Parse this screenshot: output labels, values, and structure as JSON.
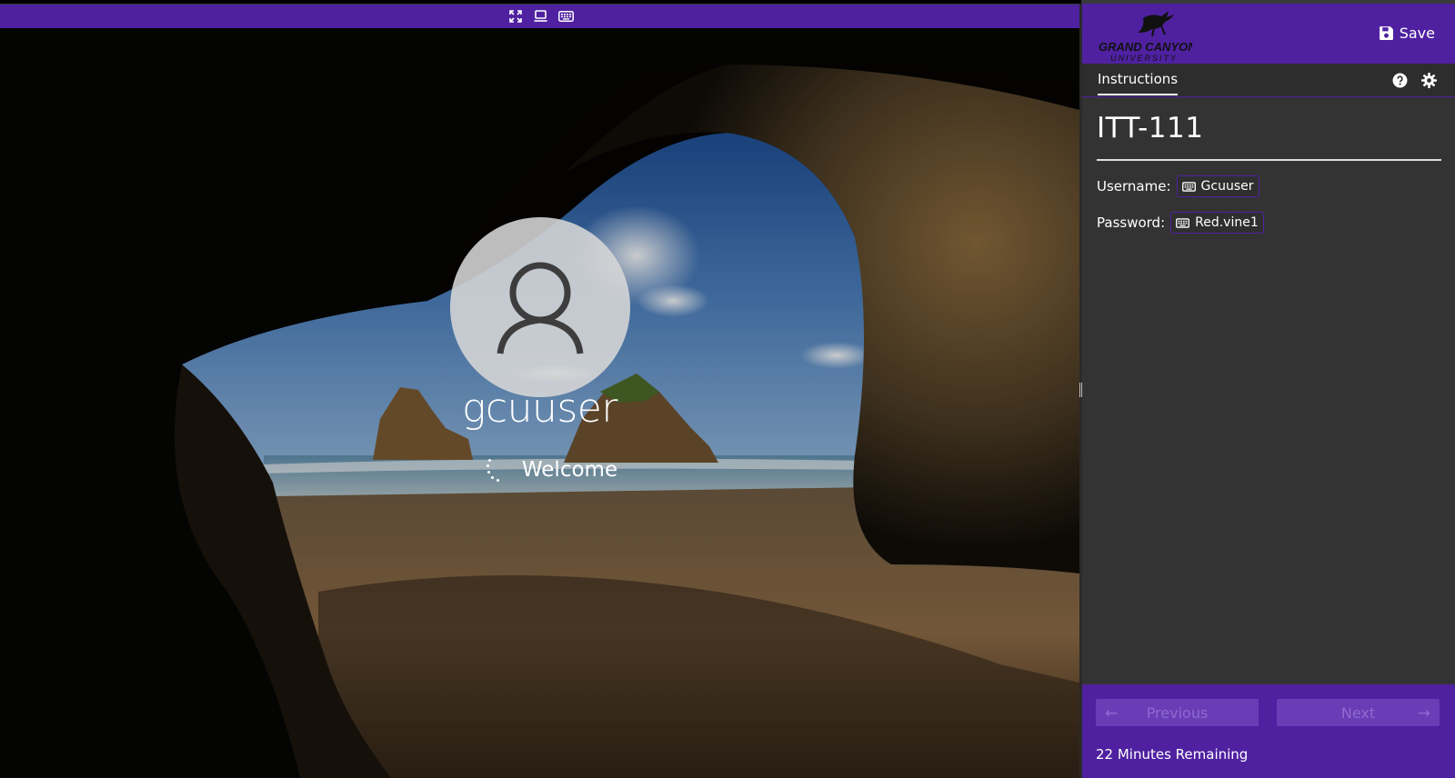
{
  "vm": {
    "toolbar": {
      "icons": [
        "fullscreen-icon",
        "display-icon",
        "keyboard-icon"
      ]
    },
    "lockscreen": {
      "username": "gcuuser",
      "status": "Welcome"
    }
  },
  "panel": {
    "logo": {
      "line1": "GRAND CANYON",
      "line2": "UNIVERSITY"
    },
    "save_label": "Save",
    "tabs": [
      {
        "label": "Instructions",
        "active": true
      }
    ],
    "course_title": "ITT-111",
    "credentials": [
      {
        "label": "Username:",
        "value": "Gcuuser"
      },
      {
        "label": "Password:",
        "value": "Red.vine1"
      }
    ],
    "footer": {
      "previous_label": "Previous",
      "next_label": "Next",
      "time_remaining": "22 Minutes Remaining"
    }
  },
  "colors": {
    "brand_purple": "#4f21a0",
    "panel_bg": "#333333",
    "button_disabled": "#6a3cb6"
  }
}
